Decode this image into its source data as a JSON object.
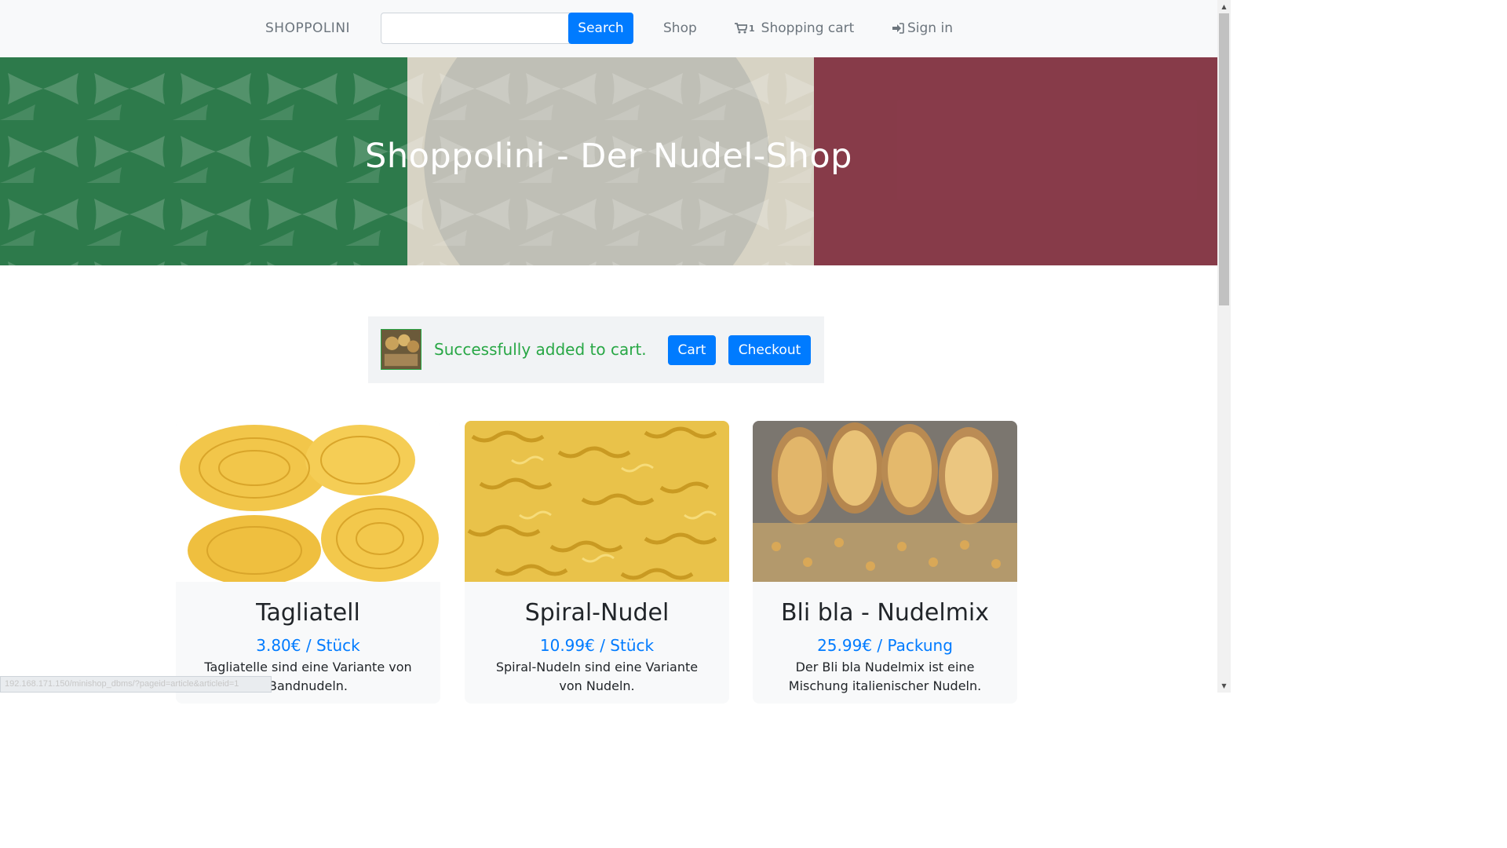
{
  "navbar": {
    "brand": "SHOPPOLINI",
    "search_value": "",
    "search_button": "Search",
    "shop_link": "Shop",
    "cart_count": "1",
    "cart_link": "Shopping cart",
    "signin_link": "Sign in"
  },
  "hero": {
    "title": "Shoppolini - Der Nudel-Shop"
  },
  "alert": {
    "message": "Successfully added to cart.",
    "cart_button": "Cart",
    "checkout_button": "Checkout"
  },
  "products": [
    {
      "name": "Tagliatell",
      "price": "3.80€ / Stück",
      "description": "Tagliatelle sind eine Variante von Bandnudeln."
    },
    {
      "name": "Spiral-Nudel",
      "price": "10.99€ / Stück",
      "description": "Spiral-Nudeln sind eine Variante von Nudeln."
    },
    {
      "name": "Bli bla - Nudelmix",
      "price": "25.99€ / Packung",
      "description": "Der Bli bla Nudelmix ist eine Mischung italienischer Nudeln."
    }
  ],
  "status_bar": {
    "url": "192.168.171.150/minishop_dbms/?pageid=article&articleid=1"
  },
  "colors": {
    "primary": "#007bff",
    "success": "#28a745",
    "flag_green": "#1e6b45",
    "flag_red": "#8a3a48"
  }
}
